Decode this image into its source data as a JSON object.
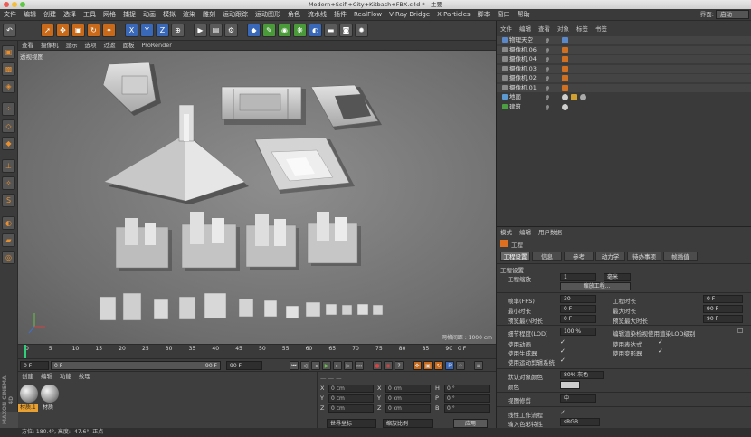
{
  "window": {
    "title": "Modern+Scifi+City+Kitbash+FBX.c4d * - 主要"
  },
  "menubar": {
    "items": [
      "文件",
      "编辑",
      "创建",
      "选择",
      "工具",
      "网格",
      "捕捉",
      "动画",
      "模拟",
      "渲染",
      "雕刻",
      "运动跟踪",
      "运动图形",
      "角色",
      "流水线",
      "插件",
      "RealFlow",
      "V-Ray Bridge",
      "X-Particles",
      "脚本",
      "窗口",
      "帮助"
    ],
    "layout_label": "界面:",
    "layout_value": "启动"
  },
  "toolbar": {
    "axes": [
      "X",
      "Y",
      "Z"
    ]
  },
  "viewport": {
    "menu": [
      "查看",
      "摄像机",
      "显示",
      "选项",
      "过滤",
      "面板",
      "ProRender"
    ],
    "label": "透视视图",
    "grid_spacing": "网格间距 : 1000 cm"
  },
  "timeline": {
    "ticks": [
      "0",
      "5",
      "10",
      "15",
      "20",
      "25",
      "30",
      "35",
      "40",
      "45",
      "50",
      "55",
      "60",
      "65",
      "70",
      "75",
      "80",
      "85",
      "90"
    ],
    "current_frame": "0 F"
  },
  "playback": {
    "start": "0 F",
    "slider_value": "0 F",
    "end1": "90 F",
    "end2": "90 F"
  },
  "materials": {
    "menu": [
      "创建",
      "编辑",
      "功能",
      "纹理"
    ],
    "items": [
      "材质.1",
      "材质"
    ]
  },
  "coordinates": {
    "rows": [
      {
        "axis": "X",
        "pos": "0 cm",
        "size": "0 cm",
        "rot_label": "H",
        "rot": "0 °"
      },
      {
        "axis": "Y",
        "pos": "0 cm",
        "size": "0 cm",
        "rot_label": "P",
        "rot": "0 °"
      },
      {
        "axis": "Z",
        "pos": "0 cm",
        "size": "0 cm",
        "rot_label": "B",
        "rot": "0 °"
      }
    ],
    "mode1": "世界坐标",
    "mode2": "缩放比例",
    "apply": "应用"
  },
  "objects": {
    "menu": [
      "文件",
      "编辑",
      "查看",
      "对象",
      "标签",
      "书签"
    ],
    "items": [
      {
        "name": "物理天空",
        "depth": 0
      },
      {
        "name": "摄像机.06",
        "depth": 0
      },
      {
        "name": "摄像机.04",
        "depth": 0
      },
      {
        "name": "摄像机.03",
        "depth": 0
      },
      {
        "name": "摄像机.02",
        "depth": 0
      },
      {
        "name": "摄像机.01",
        "depth": 0
      },
      {
        "name": "地面",
        "depth": 0
      },
      {
        "name": "建筑",
        "depth": 0
      }
    ]
  },
  "attributes": {
    "menu": [
      "模式",
      "编辑",
      "用户数据"
    ],
    "header": "工程",
    "tabs": [
      "工程设置",
      "信息",
      "参考",
      "动力学",
      "待办事项",
      "帧插值"
    ],
    "section": "工程设置",
    "scale_label": "工程缩放",
    "scale_value": "1",
    "scale_unit": "毫米",
    "scale_button": "缩放工程...",
    "fps_label": "帧率(FPS)",
    "fps_value": "30",
    "project_time_label": "工程时长",
    "project_time_value": "0 F",
    "min_time_label": "最小时长",
    "min_time_value": "0 F",
    "max_time_label": "最大时长",
    "max_time_value": "90 F",
    "preview_min_label": "预览最小时长",
    "preview_min_value": "0 F",
    "preview_max_label": "预览最大时长",
    "preview_max_value": "90 F",
    "lod_label": "细节程度(LOD)",
    "lod_value": "100 %",
    "lod_check_label": "编辑渲染检视使用渲染LOD级别",
    "use_anim": "使用动画",
    "use_expr": "使用表达式",
    "use_gen": "使用生成器",
    "use_deform": "使用变形器",
    "use_motion": "使用运动剪辑系统",
    "default_color_label": "默认对象颜色",
    "default_color_value": "80% 灰色",
    "color_label": "颜色",
    "view_clip_label": "视图修剪",
    "view_clip_value": "中",
    "linear_label": "线性工作流程",
    "input_color_label": "输入色彩特性",
    "input_color_value": "sRGB"
  },
  "status": {
    "text": "方位: 180.4°, 高度: -47.6°, 正点"
  },
  "brand": "MAXON CINEMA 4D"
}
